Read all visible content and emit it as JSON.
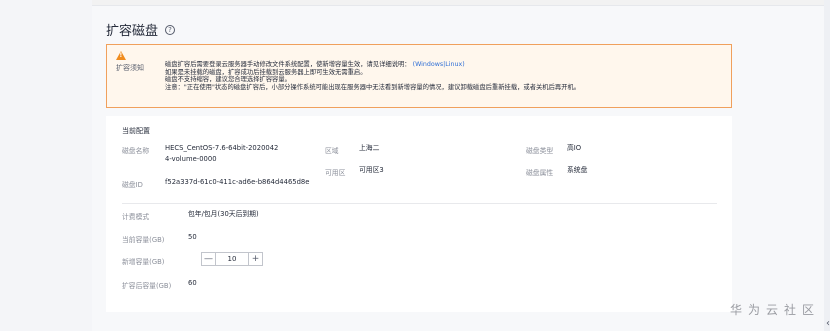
{
  "page": {
    "title": "扩容磁盘",
    "help_icon": "question-circle-icon"
  },
  "notice": {
    "icon": "warning-triangle-icon",
    "label": "扩容须知",
    "line1_prefix": "磁盘扩容后需要登录云服务器手动修改文件系统配置，使新增容量生效，请见详细说明：",
    "link_open": "(",
    "link_windows": "Windows",
    "link_sep": "|",
    "link_linux": "Linux",
    "link_close": ")",
    "line2": "如果是未挂载的磁盘，扩容成功后挂载到云服务器上即可生效无需重启。",
    "line3": "磁盘不支持缩容，建议您合理选择扩容容量。",
    "line4": "注意：\"正在使用\"状态的磁盘扩容后，小部分操作系统可能出现在服务器中无法看到新增容量的情况，建议卸载磁盘后重新挂载，或者关机后再开机。"
  },
  "config": {
    "section_title": "当前配置",
    "disk_name_label": "磁盘名称",
    "disk_name_line1": "HECS_CentOS-7.6-64bit-2020042",
    "disk_name_line2": "4-volume-0000",
    "region_label": "区域",
    "region_value": "上海二",
    "disk_type_label": "磁盘类型",
    "disk_type_value": "高IO",
    "az_label": "可用区",
    "az_value": "可用区3",
    "disk_id_label": "磁盘ID",
    "disk_id_value": "f52a337d-61c0-411c-ad6e-b864d4465d8e",
    "disk_attr_label": "磁盘属性",
    "disk_attr_value": "系统盘"
  },
  "expand": {
    "billing_label": "计费模式",
    "billing_value": "包年/包月(30天后到期)",
    "current_capacity_label": "当前容量(GB)",
    "current_capacity_value": "50",
    "new_capacity_label": "新增容量(GB)",
    "new_capacity_value": "10",
    "minus_label": "—",
    "plus_label": "+",
    "after_capacity_label": "扩容后容量(GB)",
    "after_capacity_value": "60"
  },
  "watermark": "华为云社区",
  "scroll_glyph": "‹"
}
